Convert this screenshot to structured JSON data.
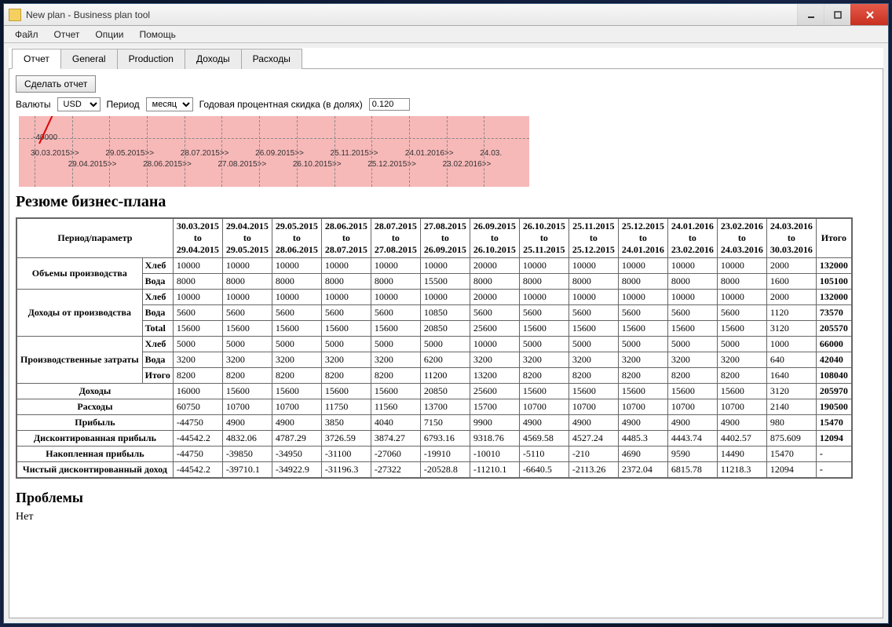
{
  "window": {
    "title": "New plan - Business plan tool"
  },
  "menu": {
    "file": "Файл",
    "report": "Отчет",
    "options": "Опции",
    "help": "Помощь"
  },
  "tabs": {
    "report": "Отчет",
    "general": "General",
    "production": "Production",
    "income": "Доходы",
    "expense": "Расходы"
  },
  "toolbar": {
    "make_report": "Сделать отчет",
    "currency_label": "Валюты",
    "currency_value": "USD",
    "period_label": "Период",
    "period_value": "месяц",
    "discount_label": "Годовая процентная скидка (в долях)",
    "discount_value": "0.120"
  },
  "chart_data": {
    "type": "line",
    "title": "",
    "ylabel": "-40000",
    "x_ticks": [
      "30.03.2015>>",
      "29.04.2015>>",
      "29.05.2015>>",
      "28.06.2015>>",
      "28.07.2015>>",
      "27.08.2015>>",
      "26.09.2015>>",
      "26.10.2015>>",
      "25.11.2015>>",
      "25.12.2015>>",
      "24.01.2016>>",
      "23.02.2016>>",
      "24.03."
    ]
  },
  "summary_title": "Резюме бизнес-плана",
  "problems_title": "Проблемы",
  "problems_text": "Нет",
  "table": {
    "period_param": "Период/параметр",
    "total_col": "Итого",
    "periods": [
      "30.03.2015 to 29.04.2015",
      "29.04.2015 to 29.05.2015",
      "29.05.2015 to 28.06.2015",
      "28.06.2015 to 28.07.2015",
      "28.07.2015 to 27.08.2015",
      "27.08.2015 to 26.09.2015",
      "26.09.2015 to 26.10.2015",
      "26.10.2015 to 25.11.2015",
      "25.11.2015 to 25.12.2015",
      "25.12.2015 to 24.01.2016",
      "24.01.2016 to 23.02.2016",
      "23.02.2016 to 24.03.2016",
      "24.03.2016 to 30.03.2016"
    ],
    "groups": [
      {
        "name": "Объемы производства",
        "rows": [
          {
            "label": "Хлеб",
            "cells": [
              "10000",
              "10000",
              "10000",
              "10000",
              "10000",
              "10000",
              "20000",
              "10000",
              "10000",
              "10000",
              "10000",
              "10000",
              "2000"
            ],
            "total": "132000"
          },
          {
            "label": "Вода",
            "cells": [
              "8000",
              "8000",
              "8000",
              "8000",
              "8000",
              "15500",
              "8000",
              "8000",
              "8000",
              "8000",
              "8000",
              "8000",
              "1600"
            ],
            "total": "105100"
          }
        ]
      },
      {
        "name": "Доходы от производства",
        "rows": [
          {
            "label": "Хлеб",
            "cells": [
              "10000",
              "10000",
              "10000",
              "10000",
              "10000",
              "10000",
              "20000",
              "10000",
              "10000",
              "10000",
              "10000",
              "10000",
              "2000"
            ],
            "total": "132000"
          },
          {
            "label": "Вода",
            "cells": [
              "5600",
              "5600",
              "5600",
              "5600",
              "5600",
              "10850",
              "5600",
              "5600",
              "5600",
              "5600",
              "5600",
              "5600",
              "1120"
            ],
            "total": "73570"
          },
          {
            "label": "Total",
            "cells": [
              "15600",
              "15600",
              "15600",
              "15600",
              "15600",
              "20850",
              "25600",
              "15600",
              "15600",
              "15600",
              "15600",
              "15600",
              "3120"
            ],
            "total": "205570"
          }
        ]
      },
      {
        "name": "Производственные затраты",
        "rows": [
          {
            "label": "Хлеб",
            "cells": [
              "5000",
              "5000",
              "5000",
              "5000",
              "5000",
              "5000",
              "10000",
              "5000",
              "5000",
              "5000",
              "5000",
              "5000",
              "1000"
            ],
            "total": "66000"
          },
          {
            "label": "Вода",
            "cells": [
              "3200",
              "3200",
              "3200",
              "3200",
              "3200",
              "6200",
              "3200",
              "3200",
              "3200",
              "3200",
              "3200",
              "3200",
              "640"
            ],
            "total": "42040"
          },
          {
            "label": "Итого",
            "cells": [
              "8200",
              "8200",
              "8200",
              "8200",
              "8200",
              "11200",
              "13200",
              "8200",
              "8200",
              "8200",
              "8200",
              "8200",
              "1640"
            ],
            "total": "108040"
          }
        ]
      }
    ],
    "simple_rows": [
      {
        "name": "Доходы",
        "cells": [
          "16000",
          "15600",
          "15600",
          "15600",
          "15600",
          "20850",
          "25600",
          "15600",
          "15600",
          "15600",
          "15600",
          "15600",
          "3120"
        ],
        "total": "205970"
      },
      {
        "name": "Расходы",
        "cells": [
          "60750",
          "10700",
          "10700",
          "11750",
          "11560",
          "13700",
          "15700",
          "10700",
          "10700",
          "10700",
          "10700",
          "10700",
          "2140"
        ],
        "total": "190500"
      },
      {
        "name": "Прибыль",
        "cells": [
          "-44750",
          "4900",
          "4900",
          "3850",
          "4040",
          "7150",
          "9900",
          "4900",
          "4900",
          "4900",
          "4900",
          "4900",
          "980"
        ],
        "total": "15470"
      },
      {
        "name": "Дисконтированная прибыль",
        "cells": [
          "-44542.2",
          "4832.06",
          "4787.29",
          "3726.59",
          "3874.27",
          "6793.16",
          "9318.76",
          "4569.58",
          "4527.24",
          "4485.3",
          "4443.74",
          "4402.57",
          "875.609"
        ],
        "total": "12094"
      },
      {
        "name": "Накопленная прибыль",
        "cells": [
          "-44750",
          "-39850",
          "-34950",
          "-31100",
          "-27060",
          "-19910",
          "-10010",
          "-5110",
          "-210",
          "4690",
          "9590",
          "14490",
          "15470"
        ],
        "total": "-"
      },
      {
        "name": "Чистый дисконтированный доход",
        "cells": [
          "-44542.2",
          "-39710.1",
          "-34922.9",
          "-31196.3",
          "-27322",
          "-20528.8",
          "-11210.1",
          "-6640.5",
          "-2113.26",
          "2372.04",
          "6815.78",
          "11218.3",
          "12094"
        ],
        "total": "-"
      }
    ]
  }
}
